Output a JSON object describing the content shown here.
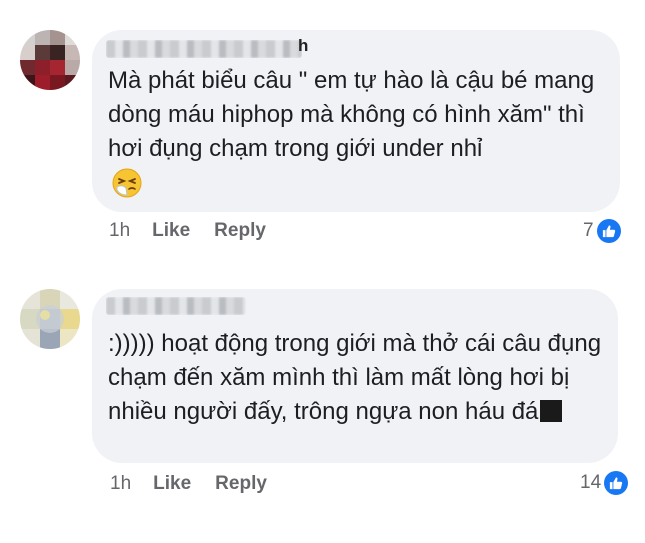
{
  "comments": [
    {
      "author_suffix": "h",
      "text": "Mà phát biểu câu \" em tự hào là cậu bé mang dòng máu hiphop mà không có hình xăm\" thì hơi đụng chạm trong giới under nhỉ",
      "emoji": "sneezing-face",
      "time": "1h",
      "like_label": "Like",
      "reply_label": "Reply",
      "reaction_count": "7"
    },
    {
      "text": ":))))) hoạt động trong giới mà thở cái câu đụng chạm đến xăm mình thì làm mất lòng hơi bị nhiều người đấy, trông ngựa non háu đá",
      "time": "1h",
      "like_label": "Like",
      "reply_label": "Reply",
      "reaction_count": "14"
    }
  ],
  "colors": {
    "bubble": "#f0f2f5",
    "meta_text": "#65676b",
    "like_blue": "#1877f2"
  },
  "icons": [
    "thumbs-up-icon",
    "sneezing-face-emoji"
  ]
}
